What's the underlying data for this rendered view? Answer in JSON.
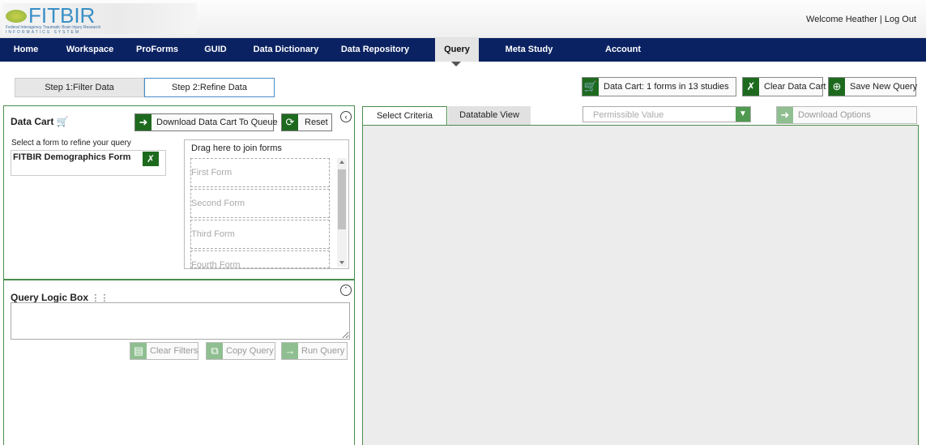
{
  "header": {
    "logo_text": "FITBIR",
    "logo_sub": "Federal Interagency Traumatic Brain Injury Research",
    "logo_sub2": "INFORMATICS SYSTEM",
    "welcome": "Welcome Heather",
    "separator": " | ",
    "logout": "Log Out"
  },
  "nav": {
    "items": [
      "Home",
      "Workspace",
      "ProForms",
      "GUID",
      "Data Dictionary",
      "Data Repository",
      "Query",
      "Meta Study",
      "Account Management"
    ],
    "active": "Query"
  },
  "steps": {
    "step1": "Step 1:Filter Data",
    "step2": "Step 2:Refine Data"
  },
  "top_buttons": {
    "data_cart": "Data Cart: 1 forms in 13 studies",
    "clear_cart": "Clear Data Cart",
    "save_query": "Save New Query"
  },
  "data_cart": {
    "title": "Data Cart",
    "download_btn": "Download Data Cart To Queue",
    "reset_btn": "Reset",
    "select_label": "Select a form to refine your query",
    "selected_form": "FITBIR Demographics Form",
    "join_title": "Drag here to join forms",
    "slots": [
      "First Form",
      "Second Form",
      "Third Form",
      "Fourth Form"
    ]
  },
  "query_logic": {
    "title": "Query Logic Box",
    "clear_filters": "Clear Filters",
    "copy_query": "Copy Query",
    "run_query": "Run Query"
  },
  "right_panel": {
    "tabs": [
      "Select Criteria",
      "Datatable View"
    ],
    "permissible_placeholder": "Permissible Value",
    "download_options": "Download Options"
  },
  "colors": {
    "nav_bg": "#0b2262",
    "accent_green": "#1d6a1f",
    "panel_border": "#4a8d4c"
  }
}
